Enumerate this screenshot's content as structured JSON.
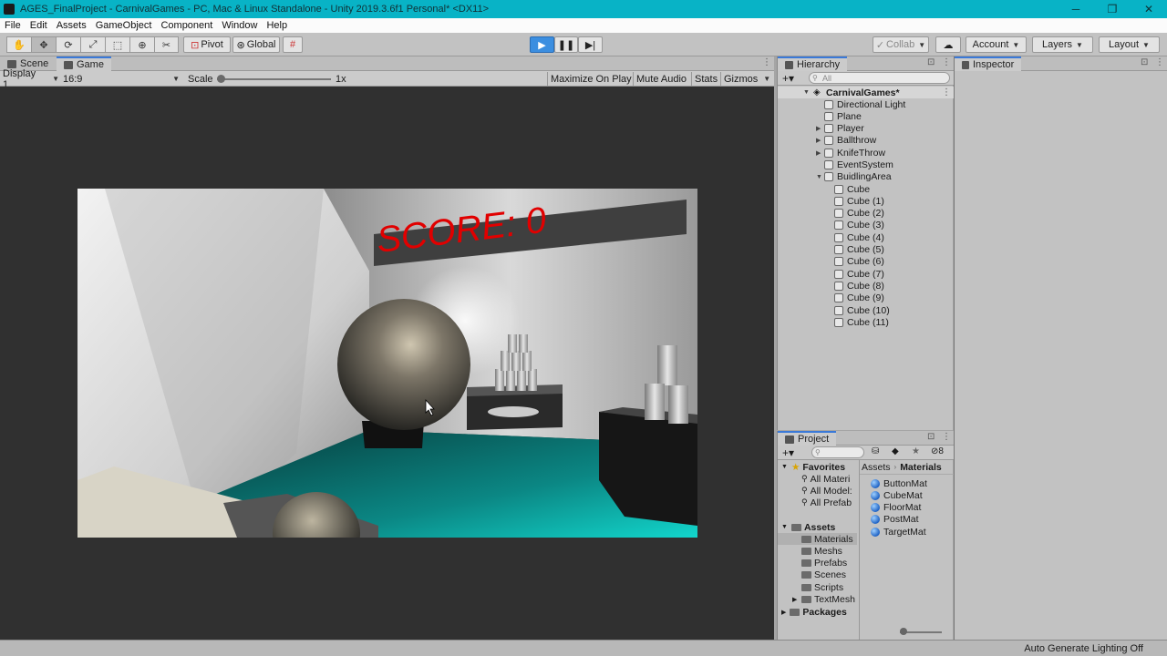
{
  "window": {
    "title": "AGES_FinalProject - CarnivalGames - PC, Mac & Linux Standalone - Unity 2019.3.6f1 Personal* <DX11>",
    "controls": [
      "─",
      "❐",
      "✕"
    ]
  },
  "menu": [
    "File",
    "Edit",
    "Assets",
    "GameObject",
    "Component",
    "Window",
    "Help"
  ],
  "toolbar": {
    "tools": [
      "hand-icon",
      "move-icon",
      "rotate-icon",
      "scale-icon",
      "rect-icon",
      "transform-icon",
      "custom-tool-icon"
    ],
    "pivot": "Pivot",
    "global": "Global",
    "collab": "Collab",
    "account": "Account",
    "layers": "Layers",
    "layout": "Layout"
  },
  "game_tabs": {
    "scene": "Scene",
    "game": "Game"
  },
  "game_toolbar": {
    "display": "Display 1",
    "aspect": "16:9",
    "scale_label": "Scale",
    "scale_value": "1x",
    "maximize": "Maximize On Play",
    "mute": "Mute Audio",
    "stats": "Stats",
    "gizmos": "Gizmos"
  },
  "game_view": {
    "score_text": "SCORE: 0",
    "score_color": "#e10000",
    "floor_color": "#0aa9a6"
  },
  "hierarchy": {
    "tab": "Hierarchy",
    "search_placeholder": "All",
    "scene": "CarnivalGames*",
    "items": [
      {
        "label": "Directional Light",
        "arrow": ""
      },
      {
        "label": "Plane",
        "arrow": ""
      },
      {
        "label": "Player",
        "arrow": "▶"
      },
      {
        "label": "Ballthrow",
        "arrow": "▶"
      },
      {
        "label": "KnifeThrow",
        "arrow": "▶"
      },
      {
        "label": "EventSystem",
        "arrow": ""
      },
      {
        "label": "BuidlingArea",
        "arrow": "▼"
      }
    ],
    "children": [
      "Cube",
      "Cube (1)",
      "Cube (2)",
      "Cube (3)",
      "Cube (4)",
      "Cube (5)",
      "Cube (6)",
      "Cube (7)",
      "Cube (8)",
      "Cube (9)",
      "Cube (10)",
      "Cube (11)"
    ]
  },
  "project": {
    "tab": "Project",
    "hidden_count": "8",
    "favorites": "Favorites",
    "favorite_items": [
      "All Materi",
      "All Model:",
      "All Prefab"
    ],
    "assets": "Assets",
    "folders": [
      "Materials",
      "Meshs",
      "Prefabs",
      "Scenes",
      "Scripts",
      "TextMesh"
    ],
    "packages": "Packages",
    "breadcrumb": [
      "Assets",
      "Materials"
    ],
    "materials": [
      "ButtonMat",
      "CubeMat",
      "FloorMat",
      "PostMat",
      "TargetMat"
    ]
  },
  "inspector": {
    "tab": "Inspector"
  },
  "status": {
    "text": "Auto Generate Lighting Off"
  },
  "colors": {
    "titlebar": "#08b3c6",
    "accent": "#3a79d8",
    "play": "#3b8ee0"
  }
}
